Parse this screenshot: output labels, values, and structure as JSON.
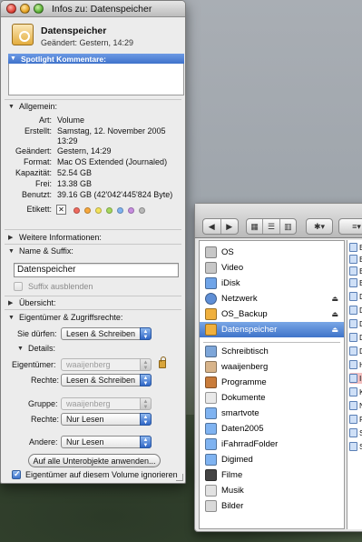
{
  "info_window": {
    "title": "Infos zu: Datenspeicher",
    "item_name": "Datenspeicher",
    "changed_line": "Geändert: Gestern, 14:29",
    "spotlight_header": "Spotlight Kommentare:",
    "general": {
      "header": "Allgemein:",
      "rows": [
        {
          "key": "Art:",
          "value": "Volume"
        },
        {
          "key": "Erstellt:",
          "value": "Samstag, 12. November 2005"
        },
        {
          "key": "",
          "value": "13:29"
        },
        {
          "key": "Geändert:",
          "value": "Gestern, 14:29"
        },
        {
          "key": "Format:",
          "value": "Mac OS Extended (Journaled)"
        },
        {
          "key": "Kapazität:",
          "value": "52.54 GB"
        },
        {
          "key": "Frei:",
          "value": "13.38 GB"
        },
        {
          "key": "Benutzt:",
          "value": "39.16 GB (42'042'445'824 Byte)"
        }
      ],
      "labels_key": "Etikett:",
      "label_colors": [
        "#ef6a5e",
        "#f7a83c",
        "#f3e25a",
        "#a6d85c",
        "#7fb3f1",
        "#c78de0",
        "#b9b9b9"
      ]
    },
    "more_info_header": "Weitere Informationen:",
    "name_suffix_header": "Name & Suffix:",
    "name_value": "Datenspeicher",
    "hide_suffix_label": "Suffix ausblenden",
    "preview_header": "Übersicht:",
    "permissions": {
      "header": "Eigentümer & Zugriffsrechte:",
      "you_can_label": "Sie dürfen:",
      "you_can_value": "Lesen & Schreiben",
      "details_header": "Details:",
      "owner_label": "Eigentümer:",
      "owner_value": "waaijenberg",
      "owner_rights_label": "Rechte:",
      "owner_rights_value": "Lesen & Schreiben",
      "group_label": "Gruppe:",
      "group_value": "waaijenberg",
      "group_rights_label": "Rechte:",
      "group_rights_value": "Nur Lesen",
      "others_label": "Andere:",
      "others_value": "Nur Lesen",
      "apply_button": "Auf alle Unterobjekte anwenden...",
      "ignore_owner_label": "Eigentümer auf diesem Volume ignorieren"
    }
  },
  "finder": {
    "toolbar": {
      "back_icon": "back-arrow-icon",
      "forward_icon": "forward-arrow-icon",
      "view_icons": [
        "icon-view-icon",
        "list-view-icon",
        "column-view-icon"
      ],
      "action_icon": "gear-icon"
    },
    "sidebar_devices": [
      {
        "label": "OS",
        "color": "#c7c7c7",
        "eject": false
      },
      {
        "label": "Video",
        "color": "#c7c7c7",
        "eject": false
      },
      {
        "label": "iDisk",
        "color": "#6fa4e8",
        "eject": false
      },
      {
        "label": "Netzwerk",
        "color": "#5f8fd6",
        "eject": true
      },
      {
        "label": "OS_Backup",
        "color": "#f0b03d",
        "eject": true
      },
      {
        "label": "Datenspeicher",
        "color": "#f0b03d",
        "eject": true,
        "selected": true
      }
    ],
    "sidebar_places": [
      {
        "label": "Schreibtisch",
        "color": "#7da6d9"
      },
      {
        "label": "waaijenberg",
        "color": "#d8b48a"
      },
      {
        "label": "Programme",
        "color": "#c97c3b"
      },
      {
        "label": "Dokumente",
        "color": "#e9e9e9"
      },
      {
        "label": "smartvote",
        "color": "#7fb3f1"
      },
      {
        "label": "Daten2005",
        "color": "#7fb3f1"
      },
      {
        "label": "iFahrradFolder",
        "color": "#7fb3f1"
      },
      {
        "label": "Digimed",
        "color": "#7fb3f1"
      },
      {
        "label": "Filme",
        "color": "#444444"
      },
      {
        "label": "Musik",
        "color": "#e2e2e2"
      },
      {
        "label": "Bilder",
        "color": "#d9d9d9"
      }
    ],
    "list_items": [
      "Ba",
      "Ba",
      "Ba",
      "Ba",
      "Da",
      "Da",
      "Di",
      "Di",
      "Do",
      "Ha",
      "In",
      "Ke",
      "Ne",
      "PE",
      "Sc",
      "Se"
    ]
  }
}
